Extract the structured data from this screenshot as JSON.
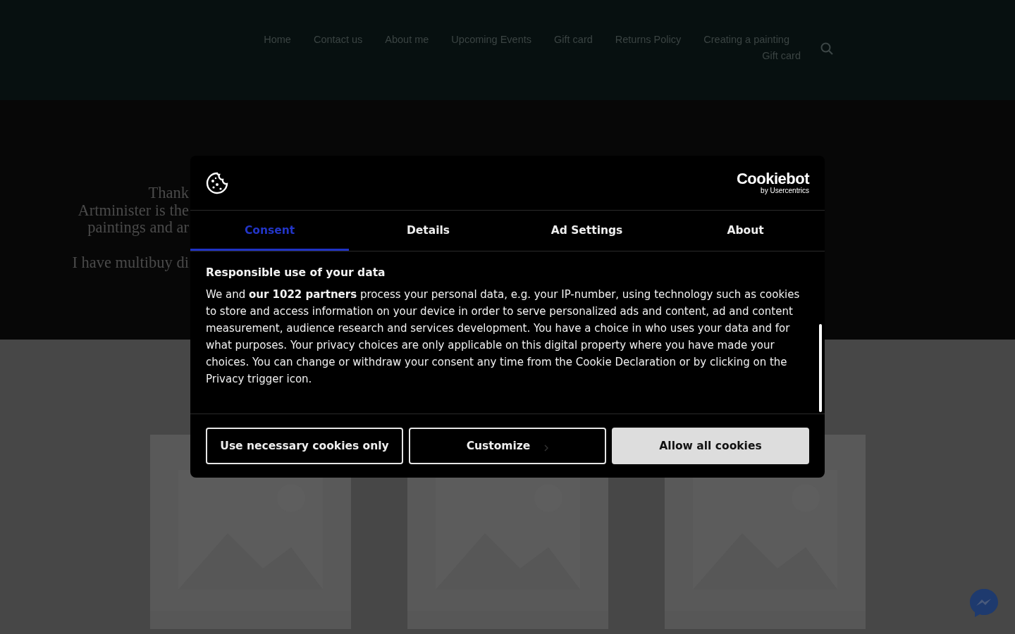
{
  "nav": {
    "items": [
      {
        "label": "Home"
      },
      {
        "label": "Contact us"
      },
      {
        "label": "About me"
      },
      {
        "label": "Upcoming Events"
      },
      {
        "label": "Gift card"
      },
      {
        "label": "Returns Policy"
      },
      {
        "label": "Creating a painting"
      },
      {
        "label": "Gift card"
      }
    ]
  },
  "hero": {
    "lines": [
      "Thank",
      "Artminister is the",
      "paintings and ar",
      "I have multibuy di"
    ]
  },
  "dialog": {
    "brand": "Cookiebot",
    "brand_sub": "by Usercentrics",
    "tabs": [
      {
        "label": "Consent",
        "selected": true
      },
      {
        "label": "Details",
        "selected": false
      },
      {
        "label": "Ad Settings",
        "selected": false
      },
      {
        "label": "About",
        "selected": false
      }
    ],
    "heading": "Responsible use of your data",
    "body": "We and **our 1022 partners** process your personal data, e.g. your IP-number, using technology such as cookies to store and access information on your device in order to serve personalized ads and content, ad and content measurement, audience research and services development. You have a choice in who uses your data and for what purposes. Your privacy choices are only applicable on this digital property where you have made your choices. You can change or withdraw your consent any time from the Cookie Declaration or by clicking on the Privacy trigger icon.",
    "buttons": [
      {
        "label": "Use necessary cookies only",
        "kind": "outline"
      },
      {
        "label": "Customize",
        "kind": "more"
      },
      {
        "label": "Allow all cookies",
        "kind": "primary"
      }
    ]
  }
}
